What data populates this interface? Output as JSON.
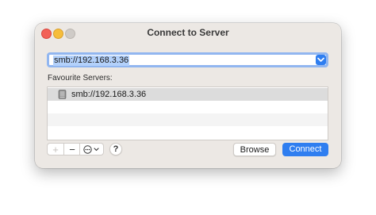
{
  "window": {
    "title": "Connect to Server"
  },
  "server_address": {
    "value": "smb://192.168.3.36"
  },
  "favourites": {
    "label": "Favourite Servers:",
    "items": [
      "smb://192.168.3.36"
    ]
  },
  "toolbar": {
    "add_symbol": "+",
    "remove_symbol": "−",
    "help_symbol": "?"
  },
  "buttons": {
    "browse": "Browse",
    "connect": "Connect"
  },
  "icons": {
    "window_close": "close-icon",
    "window_minimize": "minimize-icon",
    "window_zoom": "zoom-icon",
    "dropdown": "chevron-down-icon",
    "server": "server-icon",
    "more": "ellipsis-circle-icon"
  },
  "colors": {
    "accent": "#2f7ef0",
    "close": "#f26157",
    "minimize": "#f6bd3b",
    "zoom_disabled": "#cfcbc7",
    "selection": "#b3d1fb"
  }
}
